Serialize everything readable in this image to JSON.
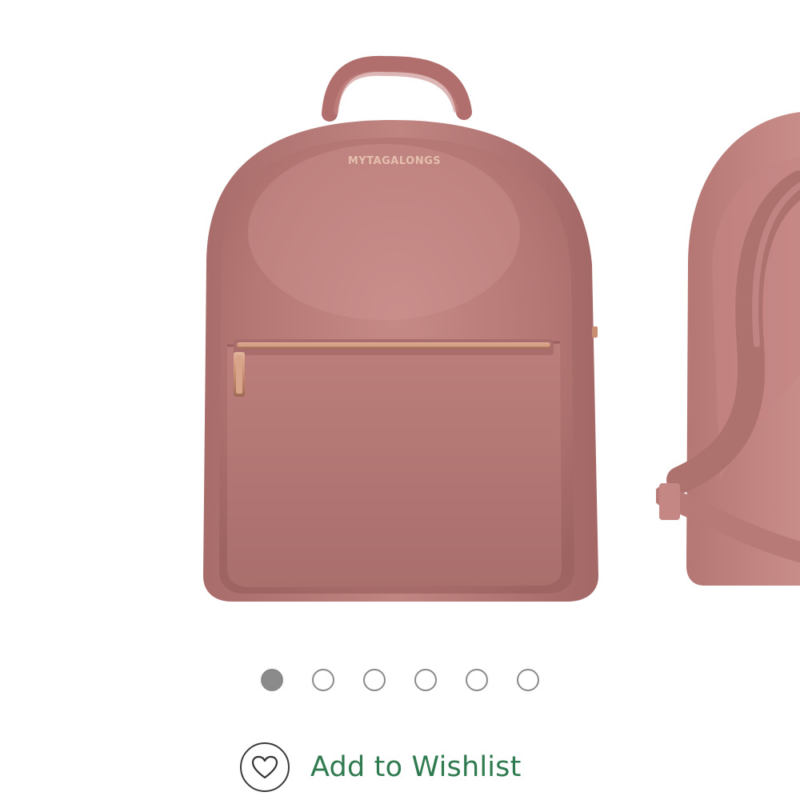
{
  "product_gallery": {
    "main_image": {
      "icon": "velvet-mini-backpack-front-image",
      "brand_text": "MYTAGALONGS",
      "color": "#b97a78"
    },
    "next_image": {
      "icon": "velvet-mini-backpack-side-image",
      "color": "#b97a78"
    },
    "dots": [
      {
        "active": true
      },
      {
        "active": false
      },
      {
        "active": false
      },
      {
        "active": false
      },
      {
        "active": false
      },
      {
        "active": false
      }
    ]
  },
  "wishlist": {
    "label": "Add to Wishlist",
    "icon": "heart-icon",
    "color": "#2f7a4f"
  }
}
